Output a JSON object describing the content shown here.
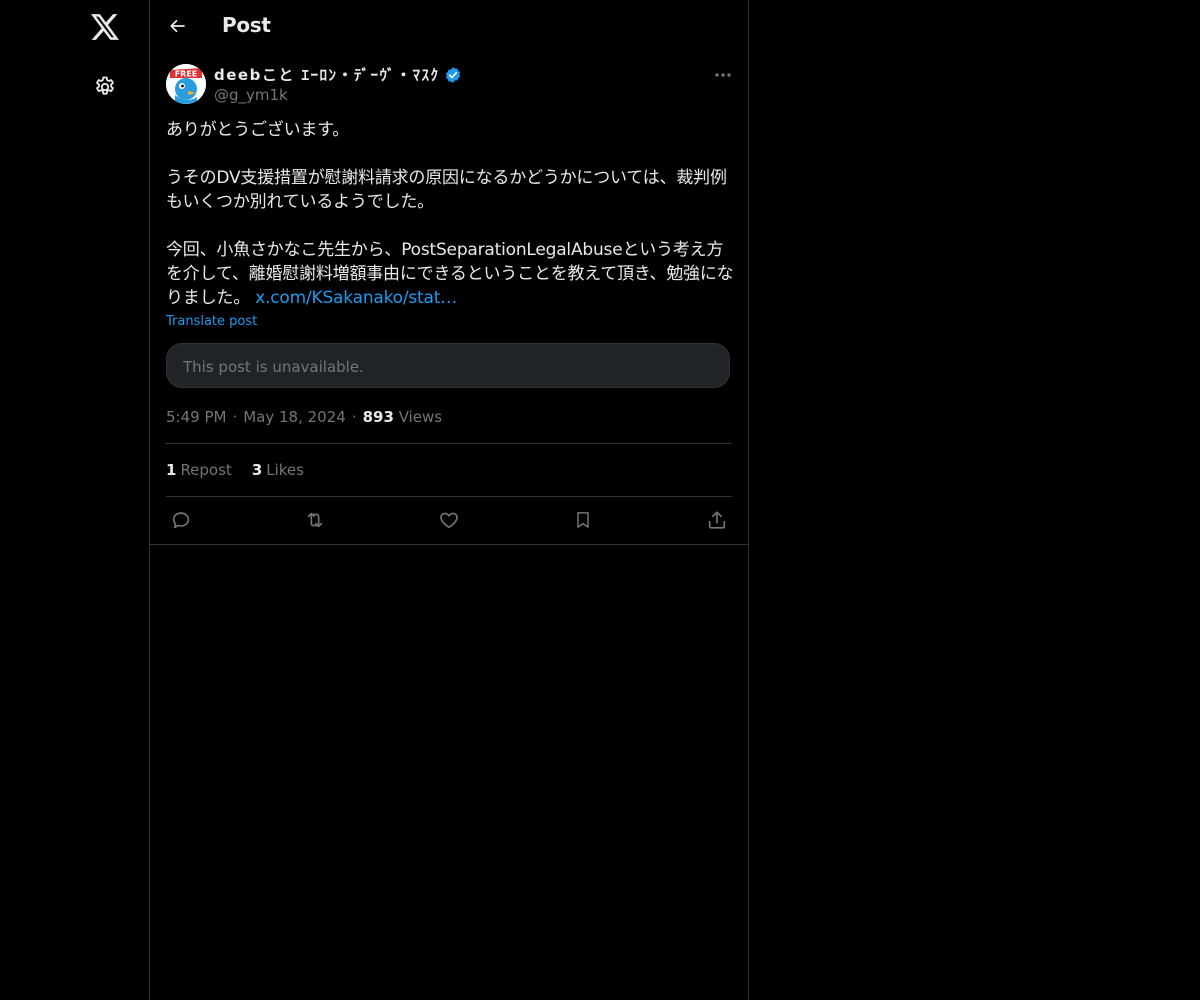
{
  "nav": {
    "logo": "x-logo-icon",
    "settings": "gear-icon"
  },
  "header": {
    "back": "arrow-left-icon",
    "title": "Post"
  },
  "post": {
    "author": {
      "name": "deebこと ｴｰﾛﾝ・ﾃﾞｰｳﾞ・ﾏｽｸ",
      "handle": "@g_ym1k",
      "verified": true
    },
    "body": {
      "p1": "ありがとうございます。",
      "p2": "うそのDV支援措置が慰謝料請求の原因になるかどうかについては、裁判例もいくつか別れているようでした。",
      "p3_text": "今回、小魚さかなこ先生から、PostSeparationLegalAbuseという考え方を介して、離婚慰謝料増額事由にできるということを教えて頂き、勉強になりました。",
      "p3_link": "x.com/KSakanako/stat…"
    },
    "translate_label": "Translate post",
    "quoted_unavailable": "This post is unavailable.",
    "time": "5:49 PM",
    "date": "May 18, 2024",
    "views_count": "893",
    "views_label": "Views",
    "separator": "·",
    "reposts_count": "1",
    "reposts_label": "Repost",
    "likes_count": "3",
    "likes_label": "Likes"
  },
  "actions": [
    "reply-icon",
    "repost-icon",
    "like-icon",
    "bookmark-icon",
    "share-icon"
  ],
  "colors": {
    "background": "#000000",
    "text": "#e7e9ea",
    "muted": "#71767b",
    "accent": "#1d9bf0",
    "border": "#2f3336",
    "card": "#202327"
  }
}
